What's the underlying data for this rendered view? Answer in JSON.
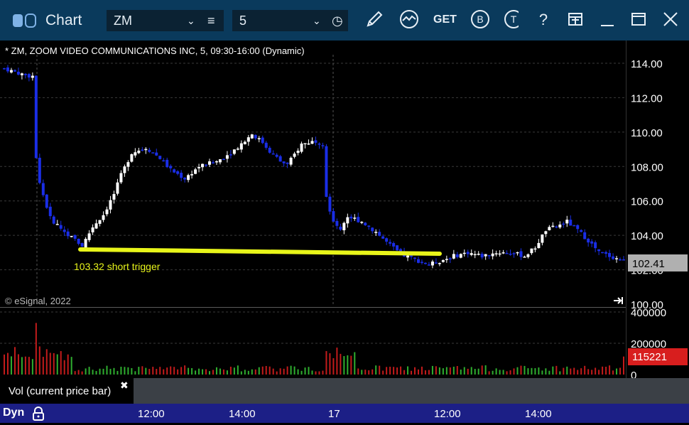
{
  "window": {
    "title": "Chart",
    "symbol": "ZM",
    "interval": "5",
    "icons": [
      "link-icon",
      "menu-icon",
      "clock-icon",
      "pencil-icon",
      "study-icon",
      "get-icon",
      "b-icon",
      "t-icon",
      "help-icon",
      "layout-icon",
      "minimize-icon",
      "maximize-icon",
      "close-icon"
    ],
    "get_label": "GET",
    "b_label": "B",
    "t_label": "T",
    "help_label": "?"
  },
  "chart": {
    "header": "* ZM, ZOOM VIDEO COMMUNICATIONS INC, 5, 09:30-16:00 (Dynamic)",
    "copyright": "© eSignal, 2022",
    "annotation": "103.32 short trigger",
    "last_price": "102.41",
    "scroll_end_icon": "skip-to-end-icon"
  },
  "volume": {
    "label": "Vol (current price bar)",
    "last_volume": "115221",
    "close_glyph": "✖"
  },
  "time_axis": {
    "mode": "Dyn",
    "ticks": [
      "12:00",
      "14:00",
      "17",
      "12:00",
      "14:00"
    ]
  },
  "colors": {
    "up": "#ffffff",
    "down": "#1a2ee6",
    "trendline": "#e8f51a",
    "vol_up": "#2fae2f",
    "vol_down": "#c21b1b",
    "last_price_bg": "#b0b0b0",
    "last_volume_bg": "#d81e1e"
  },
  "chart_data": {
    "type": "candlestick",
    "title": "* ZM, ZOOM VIDEO COMMUNICATIONS INC, 5, 09:30-16:00 (Dynamic)",
    "y_ticks": [
      "114.00",
      "112.00",
      "110.00",
      "108.00",
      "106.00",
      "104.00",
      "102.00",
      "100.00"
    ],
    "ylim": [
      100,
      115
    ],
    "volume_ticks": [
      "400000",
      "200000",
      "0"
    ],
    "volume_ylim": [
      0,
      400000
    ],
    "x_ticks": [
      "12:00",
      "14:00",
      "17",
      "12:00",
      "14:00"
    ],
    "trendline": {
      "label": "103.32 short trigger",
      "from": 103.32,
      "to": 103.1
    },
    "last_price": 102.41,
    "last_volume": 115221,
    "price_path": [
      [
        0,
        113.7
      ],
      [
        3,
        113.5
      ],
      [
        6,
        113.3
      ],
      [
        8,
        113.25
      ],
      [
        9,
        108.5
      ],
      [
        10,
        107.0
      ],
      [
        13,
        105.0
      ],
      [
        17,
        104.2
      ],
      [
        22,
        103.4
      ],
      [
        25,
        104.5
      ],
      [
        28,
        105.2
      ],
      [
        31,
        106.4
      ],
      [
        33,
        107.5
      ],
      [
        36,
        108.8
      ],
      [
        40,
        109.1
      ],
      [
        44,
        108.5
      ],
      [
        47,
        107.8
      ],
      [
        51,
        107.3
      ],
      [
        55,
        108.0
      ],
      [
        60,
        108.3
      ],
      [
        64,
        108.8
      ],
      [
        68,
        109.5
      ],
      [
        70,
        109.9
      ],
      [
        73,
        109.4
      ],
      [
        75,
        108.9
      ],
      [
        78,
        108.3
      ],
      [
        80,
        108.1
      ],
      [
        84,
        109.3
      ],
      [
        88,
        109.5
      ],
      [
        90,
        109.3
      ],
      [
        91,
        106.3
      ],
      [
        93,
        104.7
      ],
      [
        95,
        104.4
      ],
      [
        97,
        105.1
      ],
      [
        101,
        104.8
      ],
      [
        105,
        104.2
      ],
      [
        108,
        103.6
      ],
      [
        112,
        102.9
      ],
      [
        116,
        102.6
      ],
      [
        120,
        102.3
      ],
      [
        123,
        102.5
      ],
      [
        127,
        102.8
      ],
      [
        131,
        103.0
      ],
      [
        135,
        102.8
      ],
      [
        139,
        103.0
      ],
      [
        143,
        103.0
      ],
      [
        147,
        102.8
      ],
      [
        150,
        103.3
      ],
      [
        153,
        104.3
      ],
      [
        157,
        104.6
      ],
      [
        159,
        104.8
      ],
      [
        162,
        104.3
      ],
      [
        165,
        103.7
      ],
      [
        168,
        103.0
      ],
      [
        171,
        102.8
      ],
      [
        175,
        102.5
      ]
    ]
  }
}
